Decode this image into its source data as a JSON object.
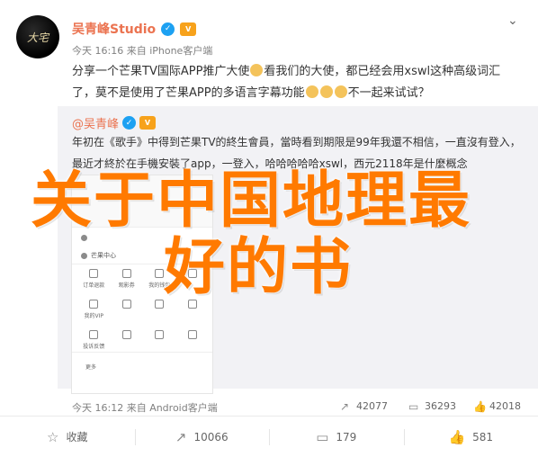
{
  "header": {
    "avatar_text": "大宅",
    "author": "吴青峰Studio",
    "meta": "今天 16:16 来自 iPhone客户端"
  },
  "post": {
    "text_1": "分享一个芒果TV国际APP推广大使",
    "text_2": "看我们的大使，都已经会用xswl这种高级词汇了，莫不是使用了芒果APP的多语言字幕功能",
    "text_3": "不一起来试试？"
  },
  "repost": {
    "author": "@吴青峰",
    "text": "年初在《歌手》中得到芒果TV的終生會員，當時看到期限是99年我還不相信，一直沒有登入，最近才終於在手機安裝了app，一登入，哈哈哈哈哈xswl，西元2118年是什麼概念",
    "phone": {
      "rows": [
        "",
        "",
        "",
        "芒果中心"
      ],
      "grid": [
        "订单退款",
        "观影券",
        "我的钱包",
        "",
        "我的VIP",
        "",
        "",
        "",
        "投诉反馈",
        "",
        "",
        ""
      ],
      "more": "更多"
    },
    "footer_meta": "今天 16:12 来自 Android客户端",
    "stats": {
      "forward": "42077",
      "comment": "36293",
      "like": "42018"
    }
  },
  "overlay": {
    "line1": "关于中国地理最",
    "line2": "好的书"
  },
  "actions": {
    "favorite": "收藏",
    "forward": "10066",
    "comment": "179",
    "like": "581"
  },
  "icons": {
    "verified": "verified-icon",
    "vip": "vip-badge-icon",
    "chevron": "chevron-down-icon"
  },
  "colors": {
    "author": "#eb7350",
    "overlay": "#ff7a00",
    "repost_bg": "#f2f2f5"
  }
}
